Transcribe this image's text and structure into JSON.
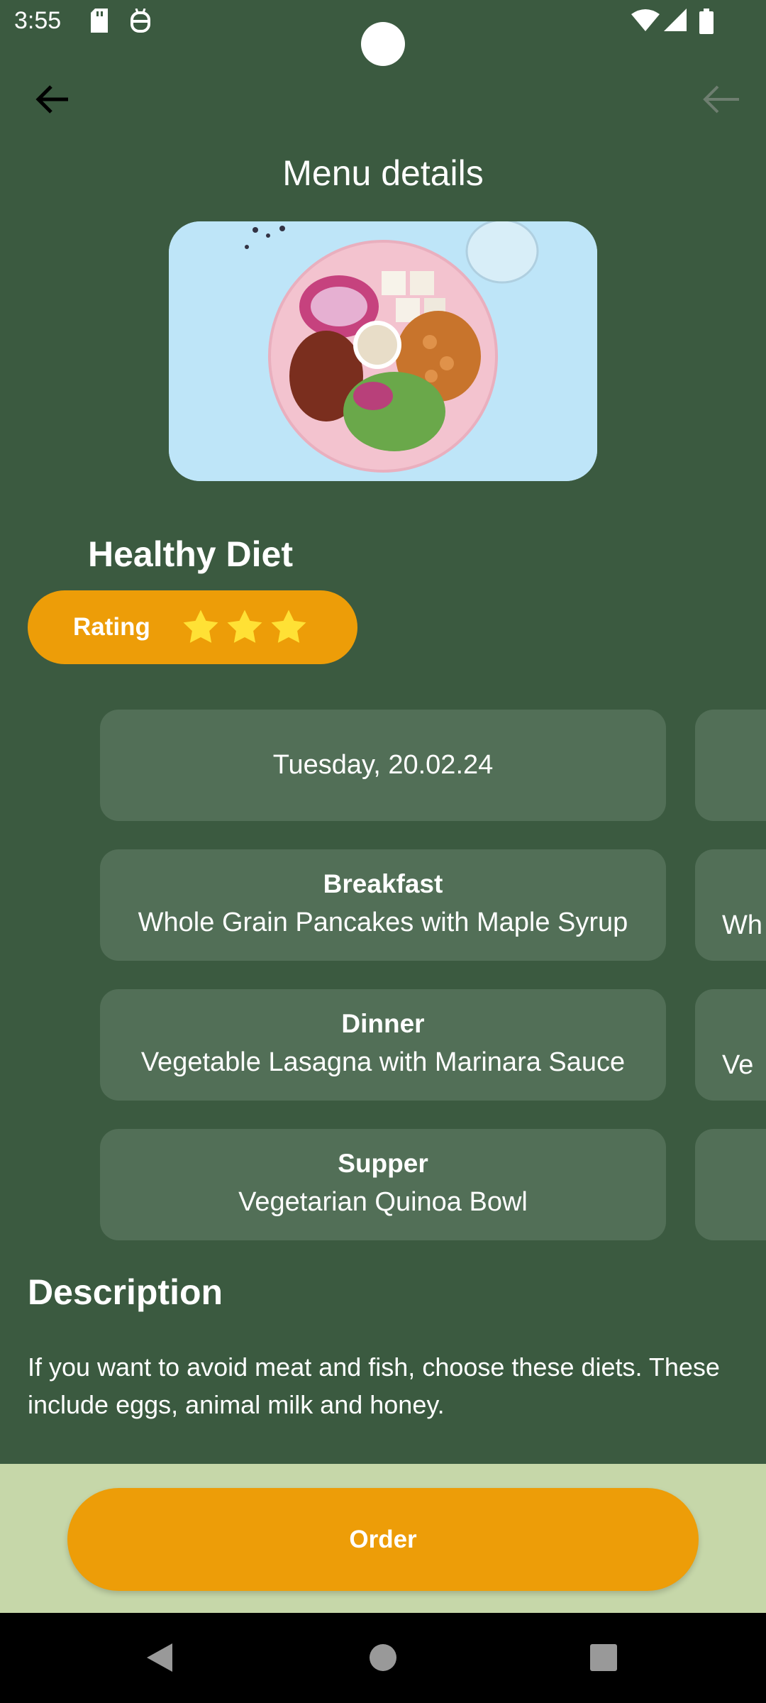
{
  "status_bar": {
    "time": "3:55",
    "icons": [
      "sd-card-icon",
      "debug-icon",
      "wifi-icon",
      "signal-icon",
      "battery-icon"
    ]
  },
  "header": {
    "title": "Menu details",
    "back_icon": "arrow-left-icon"
  },
  "diet": {
    "name": "Healthy Diet",
    "rating_label": "Rating",
    "rating_stars": 3
  },
  "menu_cards": {
    "date": "Tuesday, 20.02.24",
    "meals": [
      {
        "title": "Breakfast",
        "dish": "Whole Grain Pancakes with Maple Syrup",
        "peek": "Wh"
      },
      {
        "title": "Dinner",
        "dish": "Vegetable Lasagna with Marinara Sauce",
        "peek": "Ve"
      },
      {
        "title": "Supper",
        "dish": "Vegetarian Quinoa Bowl",
        "peek": ""
      }
    ]
  },
  "description": {
    "heading": "Description",
    "body": "If you want to avoid meat and fish, choose these diets. These include eggs, animal milk and honey."
  },
  "order_button": {
    "label": "Order"
  },
  "colors": {
    "background": "#3B5A40",
    "card": "#526F57",
    "accent": "#ED9D08",
    "star": "#FFE135",
    "bottom_bar": "#C6D7A9"
  }
}
